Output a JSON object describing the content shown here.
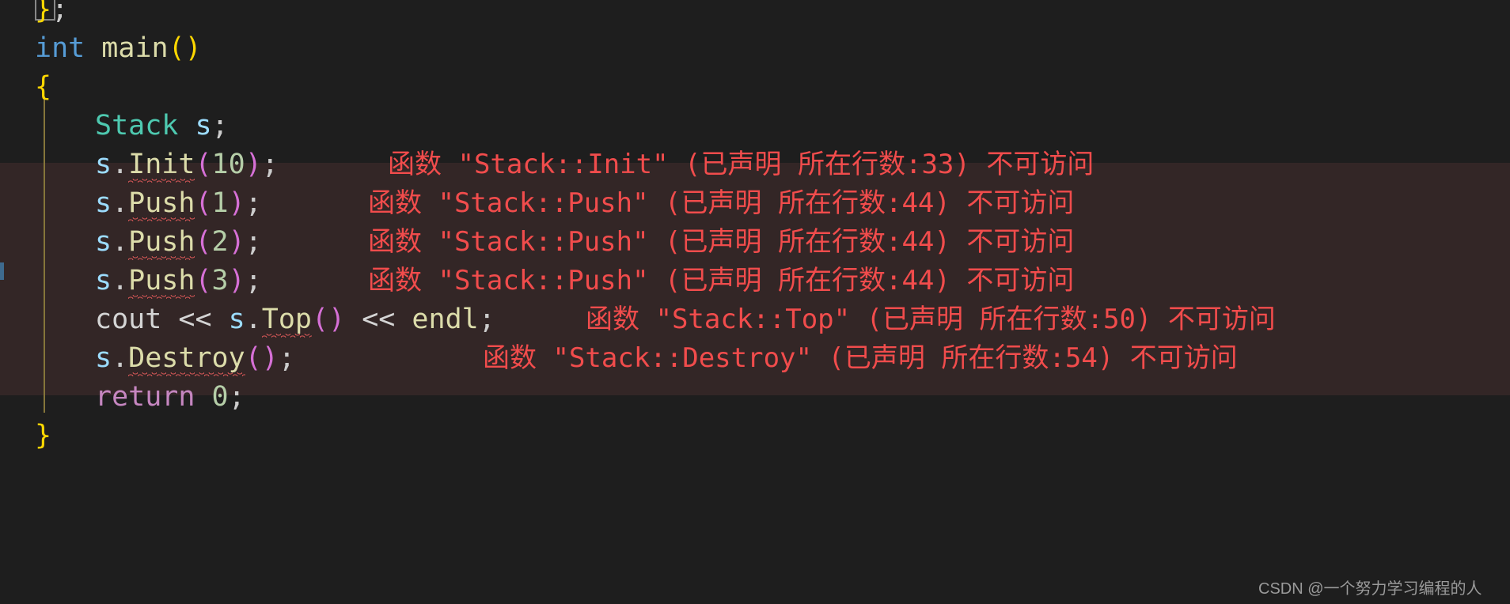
{
  "editor": {
    "background": "#1e1e1e",
    "error_band_color": "#332626",
    "indent_guide_color": "#85753a",
    "error_text_color": "#f14c4c"
  },
  "code_lines": [
    {
      "indent": "",
      "tokens": [
        {
          "text": "}",
          "style": "t-brace",
          "bracket_match": true
        },
        {
          "text": ";",
          "style": "t-punct"
        }
      ],
      "error": null
    },
    {
      "indent": "",
      "tokens": [
        {
          "text": "int",
          "style": "t-type"
        },
        {
          "text": " ",
          "style": "t-plain"
        },
        {
          "text": "main",
          "style": "t-func"
        },
        {
          "text": "()",
          "style": "t-brace"
        }
      ],
      "error": null
    },
    {
      "indent": "",
      "tokens": [
        {
          "text": "{",
          "style": "t-brace"
        }
      ],
      "error": null
    },
    {
      "indent": "    ",
      "tokens": [
        {
          "text": "Stack",
          "style": "t-class"
        },
        {
          "text": " ",
          "style": "t-plain"
        },
        {
          "text": "s",
          "style": "t-var"
        },
        {
          "text": ";",
          "style": "t-punct"
        }
      ],
      "error": null
    },
    {
      "indent": "    ",
      "tokens": [
        {
          "text": "s",
          "style": "t-var"
        },
        {
          "text": ".",
          "style": "t-punct"
        },
        {
          "text": "Init",
          "style": "t-member",
          "squiggly": true
        },
        {
          "text": "(",
          "style": "t-paren"
        },
        {
          "text": "10",
          "style": "t-num"
        },
        {
          "text": ")",
          "style": "t-paren"
        },
        {
          "text": ";",
          "style": "t-punct"
        }
      ],
      "error": "函数 \"Stack::Init\" (已声明 所在行数:33) 不可访问"
    },
    {
      "indent": "    ",
      "tokens": [
        {
          "text": "s",
          "style": "t-var"
        },
        {
          "text": ".",
          "style": "t-punct"
        },
        {
          "text": "Push",
          "style": "t-member",
          "squiggly": true
        },
        {
          "text": "(",
          "style": "t-paren"
        },
        {
          "text": "1",
          "style": "t-num"
        },
        {
          "text": ")",
          "style": "t-paren"
        },
        {
          "text": ";",
          "style": "t-punct"
        }
      ],
      "error": "函数 \"Stack::Push\" (已声明 所在行数:44) 不可访问"
    },
    {
      "indent": "    ",
      "tokens": [
        {
          "text": "s",
          "style": "t-var"
        },
        {
          "text": ".",
          "style": "t-punct"
        },
        {
          "text": "Push",
          "style": "t-member",
          "squiggly": true
        },
        {
          "text": "(",
          "style": "t-paren"
        },
        {
          "text": "2",
          "style": "t-num"
        },
        {
          "text": ")",
          "style": "t-paren"
        },
        {
          "text": ";",
          "style": "t-punct"
        }
      ],
      "error": "函数 \"Stack::Push\" (已声明 所在行数:44) 不可访问"
    },
    {
      "indent": "    ",
      "tokens": [
        {
          "text": "s",
          "style": "t-var"
        },
        {
          "text": ".",
          "style": "t-punct"
        },
        {
          "text": "Push",
          "style": "t-member",
          "squiggly": true
        },
        {
          "text": "(",
          "style": "t-paren"
        },
        {
          "text": "3",
          "style": "t-num"
        },
        {
          "text": ")",
          "style": "t-paren"
        },
        {
          "text": ";",
          "style": "t-punct"
        }
      ],
      "error": "函数 \"Stack::Push\" (已声明 所在行数:44) 不可访问"
    },
    {
      "indent": "    ",
      "tokens": [
        {
          "text": "cout",
          "style": "t-plain"
        },
        {
          "text": " << ",
          "style": "t-plain"
        },
        {
          "text": "s",
          "style": "t-var"
        },
        {
          "text": ".",
          "style": "t-punct"
        },
        {
          "text": "Top",
          "style": "t-member",
          "squiggly": true
        },
        {
          "text": "()",
          "style": "t-paren"
        },
        {
          "text": " << ",
          "style": "t-plain"
        },
        {
          "text": "endl",
          "style": "t-func"
        },
        {
          "text": ";",
          "style": "t-punct"
        }
      ],
      "error": "函数 \"Stack::Top\" (已声明 所在行数:50) 不可访问"
    },
    {
      "indent": "    ",
      "tokens": [
        {
          "text": "s",
          "style": "t-var"
        },
        {
          "text": ".",
          "style": "t-punct"
        },
        {
          "text": "Destroy",
          "style": "t-member",
          "squiggly": true
        },
        {
          "text": "()",
          "style": "t-paren"
        },
        {
          "text": ";",
          "style": "t-punct"
        }
      ],
      "error": "函数 \"Stack::Destroy\" (已声明 所在行数:54) 不可访问"
    },
    {
      "indent": "    ",
      "tokens": [
        {
          "text": "return",
          "style": "t-keyword"
        },
        {
          "text": " ",
          "style": "t-plain"
        },
        {
          "text": "0",
          "style": "t-num"
        },
        {
          "text": ";",
          "style": "t-punct"
        }
      ],
      "error": null
    },
    {
      "indent": "",
      "tokens": [
        {
          "text": "}",
          "style": "t-brace"
        }
      ],
      "error": null
    }
  ],
  "watermark": {
    "text": "CSDN @一个努力学习编程的人"
  }
}
